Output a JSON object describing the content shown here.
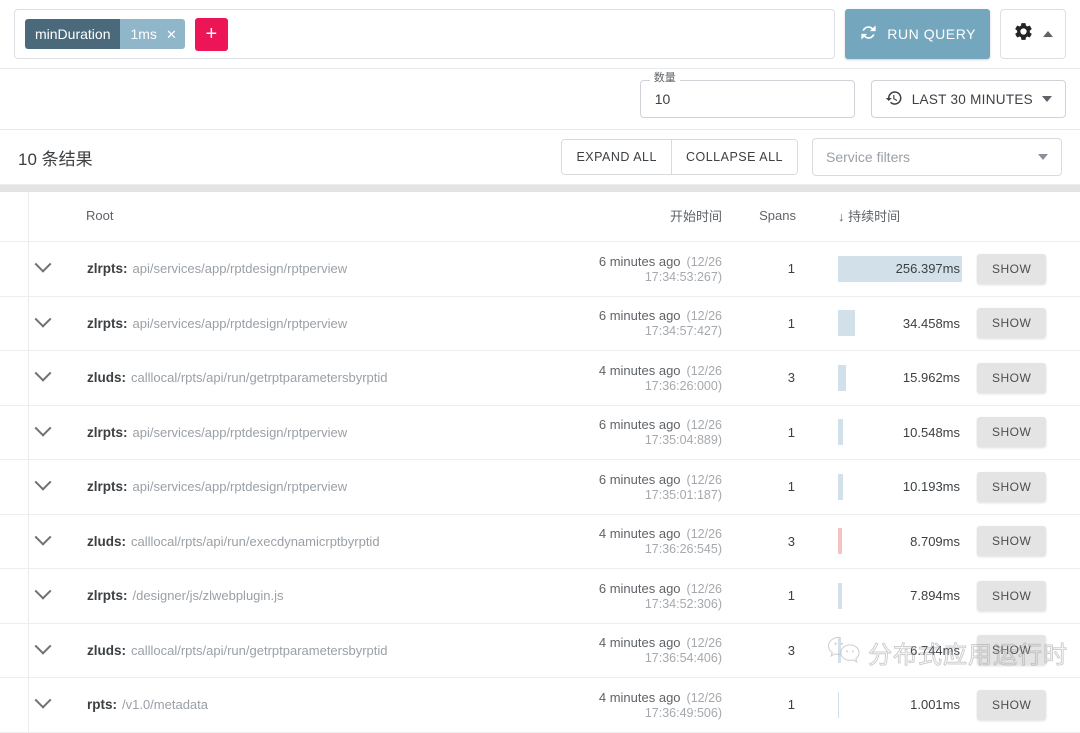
{
  "topbar": {
    "chip": {
      "key": "minDuration",
      "value": "1ms",
      "remove_icon": "✕"
    },
    "add_label": "+",
    "run_query_label": "RUN QUERY",
    "run_query_icon": "refresh-icon",
    "gear_icon": "gear-icon",
    "collapse_icon": "caret-up-icon",
    "accent_button": "#74a7bd",
    "accent_add": "#ec1556",
    "chip_key_color": "#4a697a",
    "chip_value_color": "#90b6c9"
  },
  "secondbar": {
    "limit_legend": "数量",
    "limit_value": "10",
    "limit_placeholder": "",
    "timerange_label": "LAST 30 MINUTES",
    "timerange_icon": "history-icon",
    "timerange_chevron": "chevron-down-icon"
  },
  "results": {
    "count_label": "10 条结果",
    "expand_all_label": "EXPAND ALL",
    "collapse_all_label": "COLLAPSE ALL",
    "service_filter_placeholder": "Service filters"
  },
  "table": {
    "headers": {
      "toggle": "",
      "root": "Root",
      "start": "开始时间",
      "spans": "Spans",
      "duration": "↓ 持续时间"
    },
    "show_label": "SHOW",
    "rows": [
      {
        "service": "zlrpts:",
        "operation": "api/services/app/rptdesign/rptperview",
        "relative_time": "6 minutes ago",
        "absolute_time": "(12/26 17:34:53:267)",
        "spans": "1",
        "duration": "256.397ms",
        "bar_pct": 100,
        "error": false
      },
      {
        "service": "zlrpts:",
        "operation": "api/services/app/rptdesign/rptperview",
        "relative_time": "6 minutes ago",
        "absolute_time": "(12/26 17:34:57:427)",
        "spans": "1",
        "duration": "34.458ms",
        "bar_pct": 13.4,
        "error": false
      },
      {
        "service": "zluds:",
        "operation": "calllocal/rpts/api/run/getrptparametersbyrptid",
        "relative_time": "4 minutes ago",
        "absolute_time": "(12/26 17:36:26:000)",
        "spans": "3",
        "duration": "15.962ms",
        "bar_pct": 6.2,
        "error": false
      },
      {
        "service": "zlrpts:",
        "operation": "api/services/app/rptdesign/rptperview",
        "relative_time": "6 minutes ago",
        "absolute_time": "(12/26 17:35:04:889)",
        "spans": "1",
        "duration": "10.548ms",
        "bar_pct": 4.1,
        "error": false
      },
      {
        "service": "zlrpts:",
        "operation": "api/services/app/rptdesign/rptperview",
        "relative_time": "6 minutes ago",
        "absolute_time": "(12/26 17:35:01:187)",
        "spans": "1",
        "duration": "10.193ms",
        "bar_pct": 4.0,
        "error": false
      },
      {
        "service": "zluds:",
        "operation": "calllocal/rpts/api/run/execdynamicrptbyrptid",
        "relative_time": "4 minutes ago",
        "absolute_time": "(12/26 17:36:26:545)",
        "spans": "3",
        "duration": "8.709ms",
        "bar_pct": 3.4,
        "error": true
      },
      {
        "service": "zlrpts:",
        "operation": "/designer/js/zlwebplugin.js",
        "relative_time": "6 minutes ago",
        "absolute_time": "(12/26 17:34:52:306)",
        "spans": "1",
        "duration": "7.894ms",
        "bar_pct": 3.1,
        "error": false
      },
      {
        "service": "zluds:",
        "operation": "calllocal/rpts/api/run/getrptparametersbyrptid",
        "relative_time": "4 minutes ago",
        "absolute_time": "(12/26 17:36:54:406)",
        "spans": "3",
        "duration": "6.744ms",
        "bar_pct": 2.6,
        "error": false
      },
      {
        "service": "rpts:",
        "operation": "/v1.0/metadata",
        "relative_time": "4 minutes ago",
        "absolute_time": "(12/26 17:36:49:506)",
        "spans": "1",
        "duration": "1.001ms",
        "bar_pct": 1.2,
        "error": false
      }
    ]
  },
  "watermark": {
    "text": "分布式应用运行时",
    "icon": "wechat-icon"
  }
}
